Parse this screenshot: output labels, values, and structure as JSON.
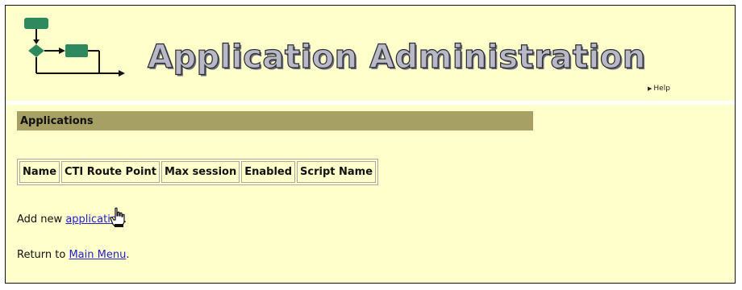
{
  "header": {
    "title": "Application Administration",
    "help_link": "Help"
  },
  "section": {
    "title": "Applications"
  },
  "table": {
    "columns": [
      "Name",
      "CTI Route Point",
      "Max session",
      "Enabled",
      "Script Name"
    ]
  },
  "actions": {
    "add_prefix": "Add new ",
    "add_link": "application",
    "add_suffix": ".",
    "return_prefix": "Return to ",
    "return_link": "Main Menu",
    "return_suffix": "."
  },
  "colors": {
    "page_background": "#ffffcc",
    "section_bar": "#a7a064",
    "logo_green": "#2e8a5e",
    "link": "#2222cc"
  },
  "icons": {
    "logo": "workflow-diagram-icon",
    "help_arrow": "triangle-right-icon",
    "cursor": "hand-pointer-cursor-icon"
  }
}
